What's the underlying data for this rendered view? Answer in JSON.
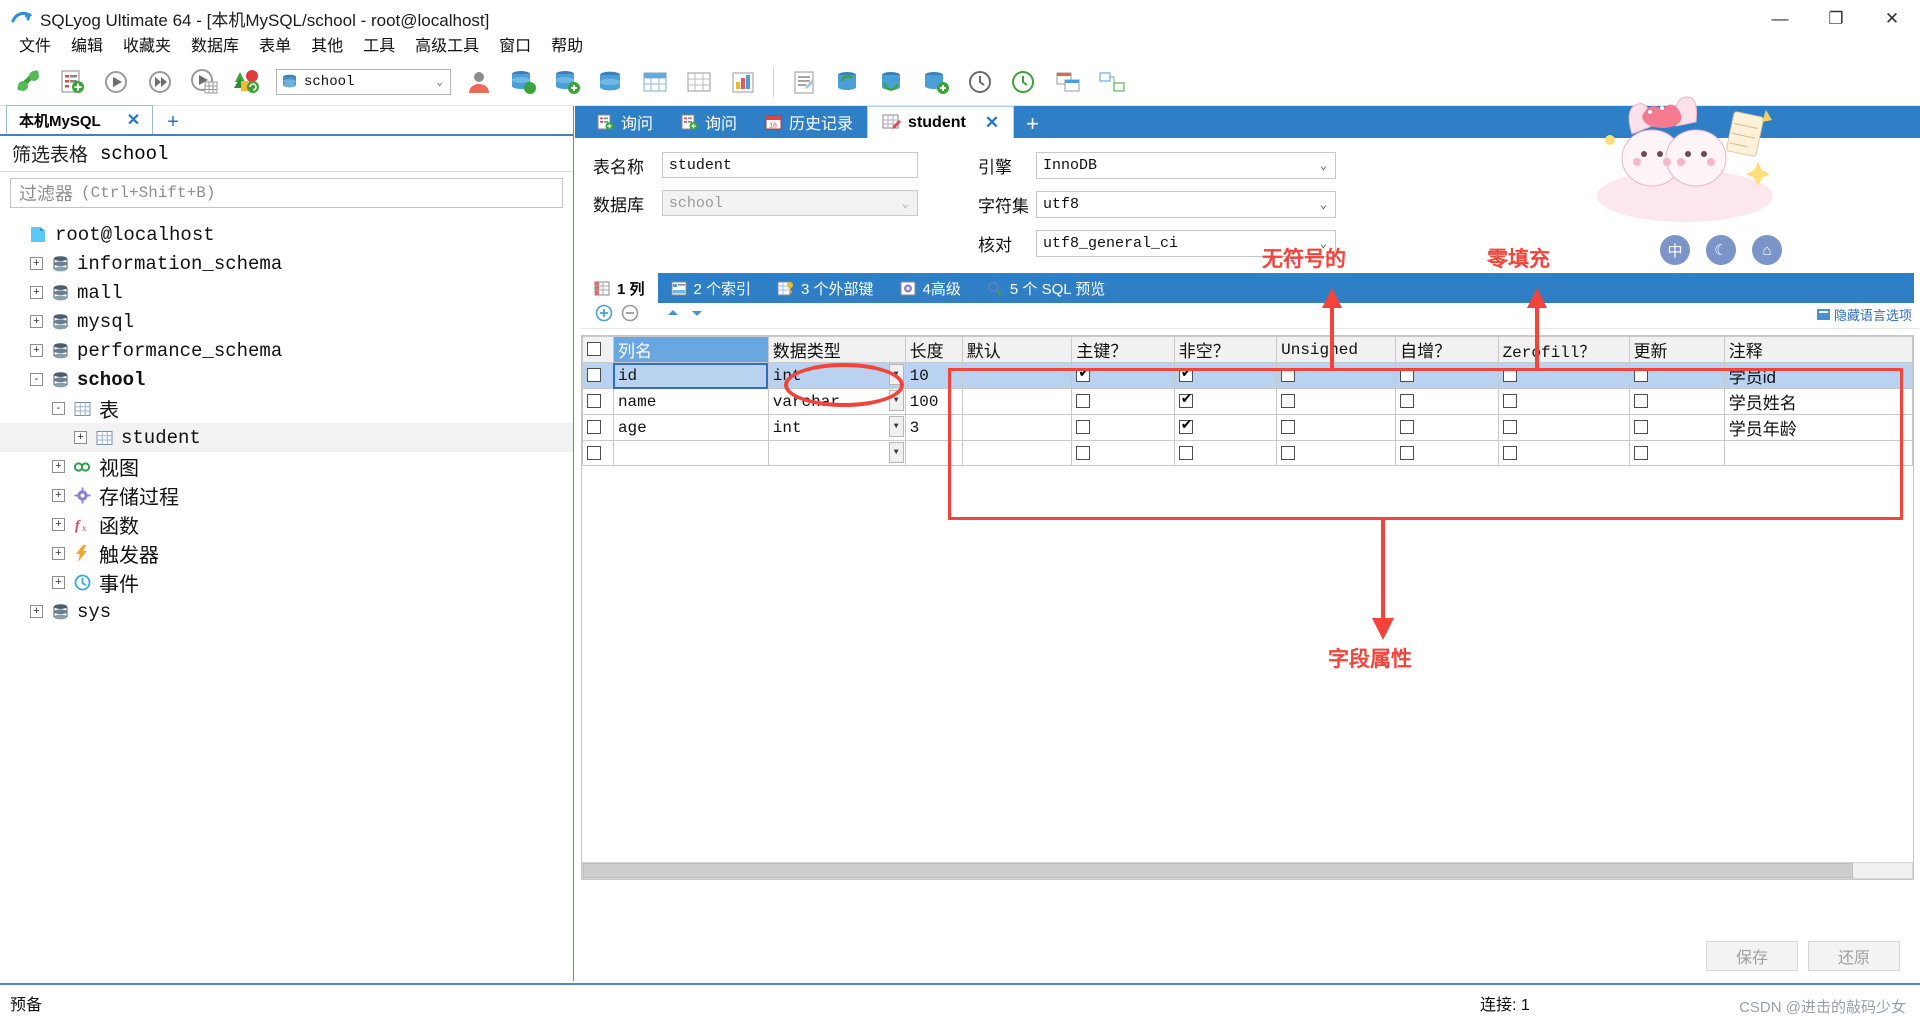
{
  "window": {
    "title": "SQLyog Ultimate 64 - [本机MySQL/school - root@localhost]",
    "minimize": "—",
    "maximize": "❐",
    "close": "✕"
  },
  "menu": {
    "items": [
      "文件",
      "编辑",
      "收藏夹",
      "数据库",
      "表单",
      "其他",
      "工具",
      "高级工具",
      "窗口",
      "帮助"
    ]
  },
  "toolbar": {
    "db_selector_value": "school",
    "db_selector_arrow": "⌄",
    "icons": [
      "connect-icon",
      "new-query-icon",
      "execute-icon",
      "execute-all-icon",
      "execute-to-grid-icon",
      "backup-icon"
    ]
  },
  "left_panel": {
    "object_tab": {
      "label": "本机MySQL",
      "close": "✕",
      "add": "+"
    },
    "filter_title_label": "筛选表格",
    "filter_title_db": "school",
    "filter_input_placeholder": "过滤器",
    "filter_input_hint": "(Ctrl+Shift+B)",
    "tree": [
      {
        "label": "root@localhost",
        "icon": "server-icon",
        "indent": 0,
        "expander": "",
        "bold": false,
        "cjk": false
      },
      {
        "label": "information_schema",
        "icon": "database-icon",
        "indent": 1,
        "expander": "+",
        "bold": false,
        "cjk": false
      },
      {
        "label": "mall",
        "icon": "database-icon",
        "indent": 1,
        "expander": "+",
        "bold": false,
        "cjk": false
      },
      {
        "label": "mysql",
        "icon": "database-icon",
        "indent": 1,
        "expander": "+",
        "bold": false,
        "cjk": false
      },
      {
        "label": "performance_schema",
        "icon": "database-icon",
        "indent": 1,
        "expander": "+",
        "bold": false,
        "cjk": false
      },
      {
        "label": "school",
        "icon": "database-icon",
        "indent": 1,
        "expander": "-",
        "bold": true,
        "cjk": false
      },
      {
        "label": "表",
        "icon": "table-folder-icon",
        "indent": 2,
        "expander": "-",
        "bold": false,
        "cjk": true
      },
      {
        "label": "student",
        "icon": "table-icon",
        "indent": 3,
        "expander": "+",
        "bold": false,
        "cjk": false,
        "selected": true
      },
      {
        "label": "视图",
        "icon": "view-icon",
        "indent": 2,
        "expander": "+",
        "bold": false,
        "cjk": true
      },
      {
        "label": "存储过程",
        "icon": "procedure-icon",
        "indent": 2,
        "expander": "+",
        "bold": false,
        "cjk": true
      },
      {
        "label": "函数",
        "icon": "function-icon",
        "indent": 2,
        "expander": "+",
        "bold": false,
        "cjk": true
      },
      {
        "label": "触发器",
        "icon": "trigger-icon",
        "indent": 2,
        "expander": "+",
        "bold": false,
        "cjk": true
      },
      {
        "label": "事件",
        "icon": "event-icon",
        "indent": 2,
        "expander": "+",
        "bold": false,
        "cjk": true
      },
      {
        "label": "sys",
        "icon": "database-icon",
        "indent": 1,
        "expander": "+",
        "bold": false,
        "cjk": false
      }
    ]
  },
  "editor_tabs": [
    {
      "label": "询问",
      "icon": "query-icon",
      "active": false,
      "closable": false
    },
    {
      "label": "询问",
      "icon": "query-icon",
      "active": false,
      "closable": false
    },
    {
      "label": "历史记录",
      "icon": "history-icon",
      "active": false,
      "closable": false
    },
    {
      "label": "student",
      "icon": "table-edit-icon",
      "active": true,
      "closable": true,
      "close": "✕"
    }
  ],
  "editor_tab_add": "+",
  "table_form": {
    "name_label": "表名称",
    "name_value": "student",
    "db_label": "数据库",
    "db_value": "school",
    "db_arrow": "⌄",
    "engine_label": "引擎",
    "engine_value": "InnoDB",
    "charset_label": "字符集",
    "charset_value": "utf8",
    "collation_label": "核对",
    "collation_value": "utf8_general_ci",
    "select_arrow": "⌄"
  },
  "sub_tabs": [
    {
      "label": "1 列",
      "icon": "columns-icon",
      "active": true
    },
    {
      "label": "2 个索引",
      "icon": "index-icon",
      "active": false
    },
    {
      "label": "3 个外部键",
      "icon": "foreign-key-icon",
      "active": false
    },
    {
      "label": "4高级",
      "icon": "advanced-icon",
      "active": false
    },
    {
      "label": "5 个 SQL 预览",
      "icon": "sql-preview-icon",
      "active": false
    }
  ],
  "grid_toolbar": {
    "add_icon": "add-row-icon",
    "remove_icon": "remove-row-icon",
    "up_icon": "move-up-icon",
    "down_icon": "move-down-icon",
    "lang_hint": "隐藏语言选项"
  },
  "grid": {
    "headers": [
      "",
      "列名",
      "数据类型",
      "长度",
      "默认",
      "主键？",
      "非空？",
      "Unsigned",
      "自增？",
      "Zerofill？",
      "更新",
      "注释"
    ],
    "rows": [
      {
        "selected": true,
        "check": false,
        "column_name": "id",
        "data_type": "int",
        "length": "10",
        "default": "",
        "primary_key": true,
        "not_null": true,
        "unsigned": false,
        "auto_increment": false,
        "zerofill": false,
        "update": false,
        "comment": "学员id"
      },
      {
        "selected": false,
        "check": false,
        "column_name": "name",
        "data_type": "varchar",
        "length": "100",
        "default": "",
        "primary_key": false,
        "not_null": true,
        "unsigned": false,
        "auto_increment": false,
        "zerofill": false,
        "update": false,
        "comment": "学员姓名"
      },
      {
        "selected": false,
        "check": false,
        "column_name": "age",
        "data_type": "int",
        "length": "3",
        "default": "",
        "primary_key": false,
        "not_null": true,
        "unsigned": false,
        "auto_increment": false,
        "zerofill": false,
        "update": false,
        "comment": "学员年龄"
      },
      {
        "selected": false,
        "check": false,
        "column_name": "",
        "data_type": "",
        "length": "",
        "default": "",
        "primary_key": false,
        "not_null": false,
        "unsigned": false,
        "auto_increment": false,
        "zerofill": false,
        "update": false,
        "comment": ""
      }
    ]
  },
  "buttons": {
    "save": "保存",
    "restore": "还原"
  },
  "status_bar": {
    "ready": "预备",
    "connection": "连接: 1",
    "watermark": "CSDN @进击的敲码少女"
  },
  "annotations": [
    {
      "text": "无符号的",
      "name": "annotation-unsigned"
    },
    {
      "text": "零填充",
      "name": "annotation-zerofill"
    },
    {
      "text": "字段属性",
      "name": "annotation-field-attributes"
    }
  ],
  "colors": {
    "accent_blue": "#2f7fc7",
    "annotation_red": "#f4433a",
    "selection_blue": "#b8d2ef",
    "header_blue": "#6aa6e0"
  }
}
